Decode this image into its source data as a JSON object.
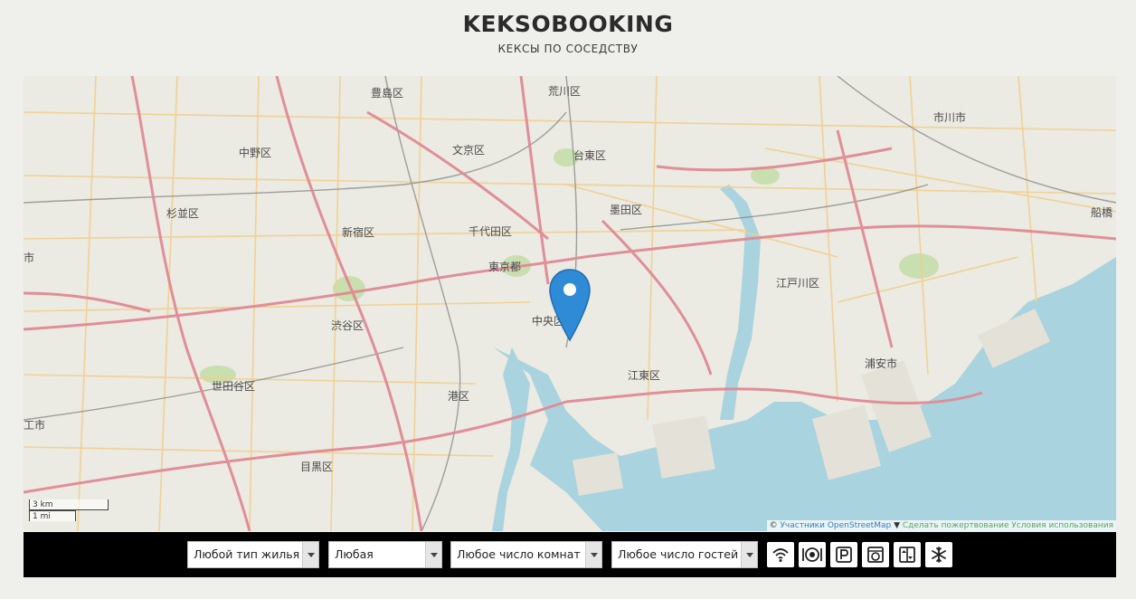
{
  "header": {
    "logo": "KEKSOBOOKING",
    "tagline": "КЕКСЫ ПО СОСЕДСТВУ"
  },
  "map": {
    "districts": [
      "荒川区",
      "豊島区",
      "中野区",
      "文京区",
      "台東区",
      "杉並区",
      "新宿区",
      "千代田区",
      "墨田区",
      "市",
      "東京都",
      "江戸川区",
      "渋谷区",
      "中央区",
      "江東区",
      "世田谷区",
      "港区",
      "浦安市",
      "目黒区",
      "市川市",
      "工市",
      "船橋"
    ],
    "scale": {
      "metric": "3 km",
      "imperial": "1 mi"
    },
    "attribution": {
      "prefix": "©",
      "contributors": "Участники OpenStreetMap",
      "sep": "▼",
      "improve": "Сделать пожертвование",
      "terms": "Условия использования"
    },
    "colors": {
      "water": "#a9d3de",
      "land": "#ebeae3",
      "major_road": "#e08a93",
      "minor_road": "#f2cf8a",
      "pin": "#2f8bd6"
    }
  },
  "filters": {
    "type": "Любой тип жилья",
    "price": "Любая",
    "rooms": "Любое число комнат",
    "guests": "Любое число гостей",
    "features": [
      "wifi-icon",
      "dishwasher-icon",
      "parking-icon",
      "washer-icon",
      "elevator-icon",
      "conditioner-icon"
    ]
  }
}
